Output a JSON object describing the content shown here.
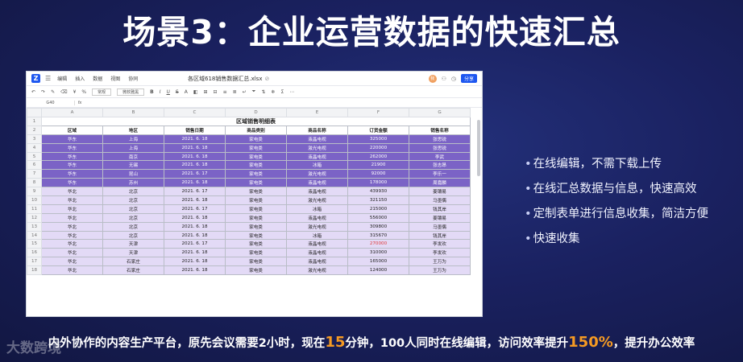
{
  "slide": {
    "title": "场景3：企业运营数据的快速汇总",
    "bullets": [
      "在线编辑，不需下载上传",
      "在线汇总数据与信息，快速高效",
      "定制表单进行信息收集，简洁方便",
      "快速收集"
    ],
    "footer": {
      "part1": "内外协作的内容生产平台，原先会议需要2小时，现在",
      "num1": "15",
      "part2": "分钟，100人同时在线编辑，访问效率提升",
      "num2": "150%",
      "part3": "，提升办公效率"
    },
    "watermark": "大数跨境",
    "accent_color": "#f59a23"
  },
  "app": {
    "logo": "Z",
    "menu": [
      "编辑",
      "插入",
      "数据",
      "视图",
      "协同"
    ],
    "doc_title": "各区域618销售数据汇总.xlsx",
    "avatar": "我",
    "share": "分享",
    "toolbar_font": "微软雅黑",
    "toolbar_format": "常规",
    "cell_ref": "G40",
    "fx": "fx"
  },
  "sheet": {
    "columns": [
      "A",
      "B",
      "C",
      "D",
      "E",
      "F",
      "G"
    ],
    "title": "区域销售明细表",
    "headers": [
      "区域",
      "地区",
      "销售日期",
      "商品类别",
      "商品名称",
      "订货金额",
      "销售名称"
    ],
    "rows": [
      [
        "华东",
        "上海",
        "2021. 6. 18",
        "家电类",
        "液晶电视",
        "325000",
        "张思锐"
      ],
      [
        "华东",
        "上海",
        "2021. 6. 18",
        "家电类",
        "激光电视",
        "220000",
        "张思锐"
      ],
      [
        "华东",
        "南京",
        "2021. 6. 18",
        "家电类",
        "液晶电视",
        "262000",
        "李武"
      ],
      [
        "华东",
        "无锡",
        "2021. 6. 18",
        "家电类",
        "冰箱",
        "21900",
        "张志昂"
      ],
      [
        "华东",
        "昆山",
        "2021. 6. 17",
        "家电类",
        "激光电视",
        "92000",
        "李乐一"
      ],
      [
        "华东",
        "苏州",
        "2021. 6. 18",
        "家电类",
        "液晶电视",
        "178000",
        "周嘉麟"
      ],
      [
        "华北",
        "北京",
        "2021. 6. 17",
        "家电类",
        "液晶电视",
        "439930",
        "姜镶易"
      ],
      [
        "华北",
        "北京",
        "2021. 6. 18",
        "家电类",
        "激光电视",
        "321150",
        "马墨偶"
      ],
      [
        "华北",
        "北京",
        "2021. 6. 17",
        "家电类",
        "冰箱",
        "215000",
        "钱其岸"
      ],
      [
        "华北",
        "北京",
        "2021. 6. 18",
        "家电类",
        "液晶电视",
        "556000",
        "姜镶易"
      ],
      [
        "华北",
        "北京",
        "2021. 6. 18",
        "家电类",
        "激光电视",
        "309800",
        "马墨偶"
      ],
      [
        "华北",
        "北京",
        "2021. 6. 18",
        "家电类",
        "冰箱",
        "315670",
        "钱其岸"
      ],
      [
        "华北",
        "天津",
        "2021. 6. 17",
        "家电类",
        "液晶电视",
        "270000",
        "李发欢"
      ],
      [
        "华北",
        "天津",
        "2021. 6. 18",
        "家电类",
        "液晶电视",
        "310000",
        "李发欢"
      ],
      [
        "华北",
        "石家庄",
        "2021. 6. 18",
        "家电类",
        "液晶电视",
        "165000",
        "王万为"
      ],
      [
        "华北",
        "石家庄",
        "2021. 6. 18",
        "家电类",
        "激光电视",
        "124000",
        "王万为"
      ]
    ]
  }
}
